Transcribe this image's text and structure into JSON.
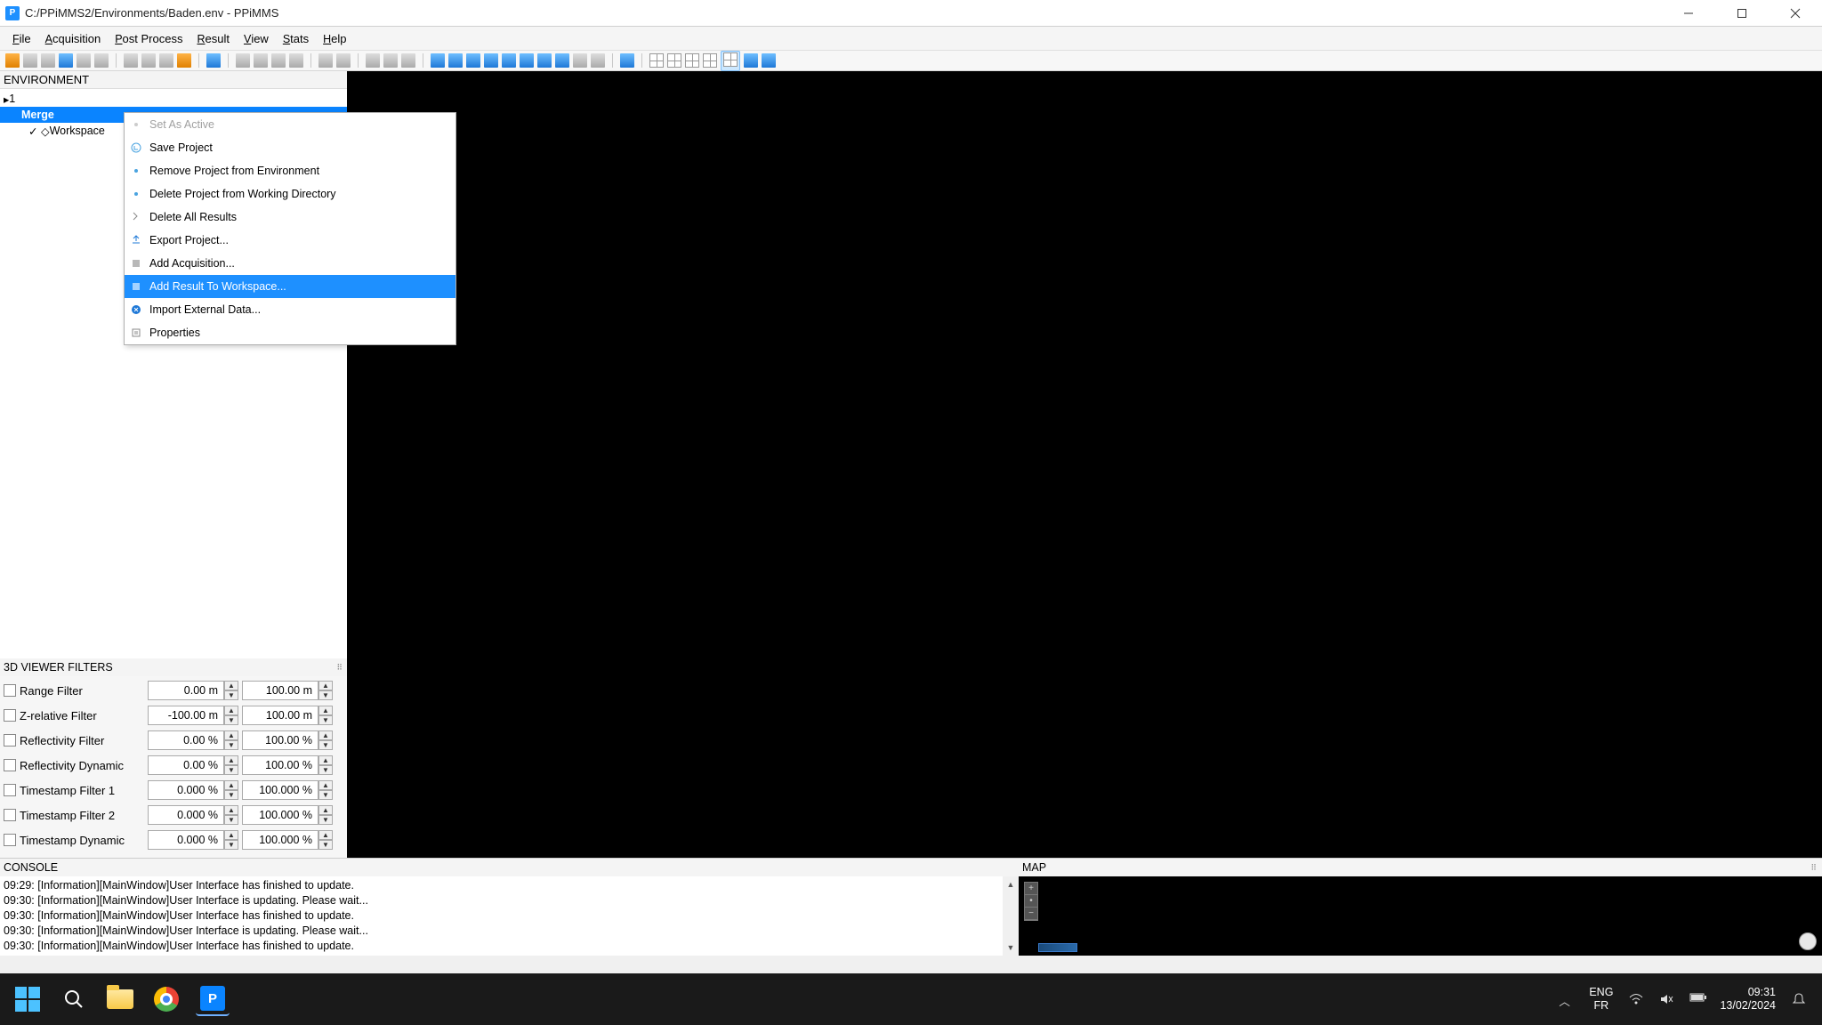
{
  "window": {
    "title": "C:/PPiMMS2/Environments/Baden.env - PPiMMS",
    "minimize": "—",
    "maximize": "☐",
    "close": "✕"
  },
  "menubar": [
    "File",
    "Acquisition",
    "Post Process",
    "Result",
    "View",
    "Stats",
    "Help"
  ],
  "env_panel": {
    "header": "ENVIRONMENT",
    "items": {
      "one": "1",
      "merge": "Merge",
      "workspace": "Workspace"
    }
  },
  "context_menu": [
    {
      "label": "Set As Active",
      "disabled": true
    },
    {
      "label": "Save Project",
      "icon": "save"
    },
    {
      "label": "Remove Project from Environment",
      "icon": "dot-blue"
    },
    {
      "label": "Delete Project from Working Directory",
      "icon": "dot-blue"
    },
    {
      "label": "Delete All Results",
      "icon": "caret"
    },
    {
      "label": "Export Project...",
      "icon": "export"
    },
    {
      "label": "Add Acquisition...",
      "icon": "square"
    },
    {
      "label": "Add Result To Workspace...",
      "icon": "square",
      "hover": true
    },
    {
      "label": "Import External Data...",
      "icon": "import"
    },
    {
      "label": "Properties",
      "icon": "props"
    }
  ],
  "filters": {
    "header": "3D VIEWER FILTERS",
    "rows": [
      {
        "label": "Range Filter",
        "min": "0.00 m",
        "max": "100.00 m"
      },
      {
        "label": "Z-relative Filter",
        "min": "-100.00 m",
        "max": "100.00 m"
      },
      {
        "label": "Reflectivity Filter",
        "min": "0.00 %",
        "max": "100.00 %"
      },
      {
        "label": "Reflectivity Dynamic",
        "min": "0.00 %",
        "max": "100.00 %"
      },
      {
        "label": "Timestamp Filter 1",
        "min": "0.000 %",
        "max": "100.000 %"
      },
      {
        "label": "Timestamp Filter 2",
        "min": "0.000 %",
        "max": "100.000 %"
      },
      {
        "label": "Timestamp Dynamic",
        "min": "0.000 %",
        "max": "100.000 %"
      }
    ]
  },
  "console": {
    "header": "CONSOLE",
    "lines": [
      "09:29: [Information][MainWindow]User Interface has finished to update.",
      "09:30: [Information][MainWindow]User Interface is updating. Please wait...",
      "09:30: [Information][MainWindow]User Interface has finished to update.",
      "09:30: [Information][MainWindow]User Interface is updating. Please wait...",
      "09:30: [Information][MainWindow]User Interface has finished to update."
    ]
  },
  "map": {
    "header": "MAP"
  },
  "taskbar": {
    "lang_top": "ENG",
    "lang_bottom": "FR",
    "time": "09:31",
    "date": "13/02/2024"
  }
}
